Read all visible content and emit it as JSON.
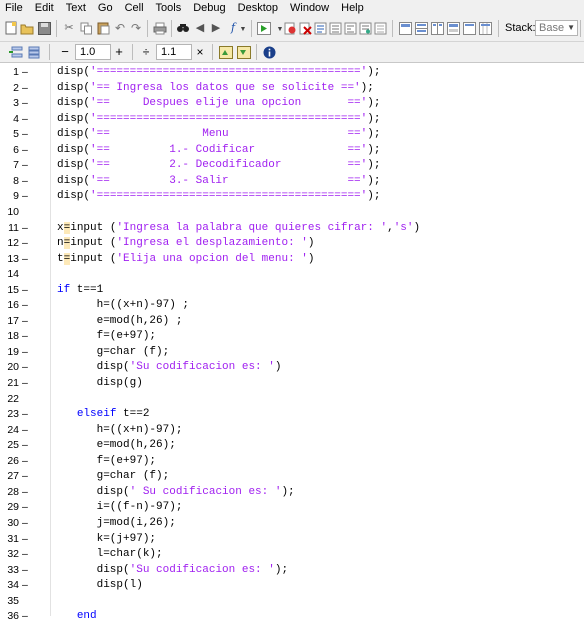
{
  "menu": [
    "File",
    "Edit",
    "Text",
    "Go",
    "Cell",
    "Tools",
    "Debug",
    "Desktop",
    "Window",
    "Help"
  ],
  "toolbar": {
    "stack_label": "Stack:",
    "stack_value": "Base",
    "cell_minus": "−",
    "cell_value_1": "1.0",
    "cell_plus": "+",
    "cell_divide": "÷",
    "cell_value_2": "1.1",
    "cell_times": "×"
  },
  "code_lines": [
    {
      "n": "1",
      "parts": [
        {
          "t": "disp(",
          "c": ""
        },
        {
          "t": "'========================================'",
          "c": "str"
        },
        {
          "t": ");",
          "c": ""
        }
      ]
    },
    {
      "n": "2",
      "parts": [
        {
          "t": "disp(",
          "c": ""
        },
        {
          "t": "'== Ingresa los datos que se solicite =='",
          "c": "str"
        },
        {
          "t": ");",
          "c": ""
        }
      ]
    },
    {
      "n": "3",
      "parts": [
        {
          "t": "disp(",
          "c": ""
        },
        {
          "t": "'==     Despues elije una opcion       =='",
          "c": "str"
        },
        {
          "t": ");",
          "c": ""
        }
      ]
    },
    {
      "n": "4",
      "parts": [
        {
          "t": "disp(",
          "c": ""
        },
        {
          "t": "'========================================'",
          "c": "str"
        },
        {
          "t": ");",
          "c": ""
        }
      ]
    },
    {
      "n": "5",
      "parts": [
        {
          "t": "disp(",
          "c": ""
        },
        {
          "t": "'==              Menu                  =='",
          "c": "str"
        },
        {
          "t": ");",
          "c": ""
        }
      ]
    },
    {
      "n": "6",
      "parts": [
        {
          "t": "disp(",
          "c": ""
        },
        {
          "t": "'==         1.- Codificar              =='",
          "c": "str"
        },
        {
          "t": ");",
          "c": ""
        }
      ]
    },
    {
      "n": "7",
      "parts": [
        {
          "t": "disp(",
          "c": ""
        },
        {
          "t": "'==         2.- Decodificador          =='",
          "c": "str"
        },
        {
          "t": ");",
          "c": ""
        }
      ]
    },
    {
      "n": "8",
      "parts": [
        {
          "t": "disp(",
          "c": ""
        },
        {
          "t": "'==         3.- Salir                  =='",
          "c": "str"
        },
        {
          "t": ");",
          "c": ""
        }
      ]
    },
    {
      "n": "9",
      "parts": [
        {
          "t": "disp(",
          "c": ""
        },
        {
          "t": "'========================================'",
          "c": "str"
        },
        {
          "t": ");",
          "c": ""
        }
      ]
    },
    {
      "n": "10",
      "dash": false,
      "parts": []
    },
    {
      "n": "11",
      "parts": [
        {
          "t": "x",
          "c": ""
        },
        {
          "t": "=",
          "c": "mark"
        },
        {
          "t": "input (",
          "c": ""
        },
        {
          "t": "'Ingresa la palabra que quieres cifrar: '",
          "c": "str"
        },
        {
          "t": ",",
          "c": ""
        },
        {
          "t": "'s'",
          "c": "str"
        },
        {
          "t": ")",
          "c": ""
        }
      ]
    },
    {
      "n": "12",
      "parts": [
        {
          "t": "n",
          "c": ""
        },
        {
          "t": "=",
          "c": "mark"
        },
        {
          "t": "input (",
          "c": ""
        },
        {
          "t": "'Ingresa el desplazamiento: '",
          "c": "str"
        },
        {
          "t": ")",
          "c": ""
        }
      ]
    },
    {
      "n": "13",
      "parts": [
        {
          "t": "t",
          "c": ""
        },
        {
          "t": "=",
          "c": "mark"
        },
        {
          "t": "input (",
          "c": ""
        },
        {
          "t": "'Elija una opcion del menu: '",
          "c": "str"
        },
        {
          "t": ")",
          "c": ""
        }
      ]
    },
    {
      "n": "14",
      "dash": false,
      "parts": []
    },
    {
      "n": "15",
      "parts": [
        {
          "t": "if",
          "c": "kw"
        },
        {
          "t": " t==1",
          "c": ""
        }
      ]
    },
    {
      "n": "16",
      "parts": [
        {
          "t": "      h=((x+n)-97) ;",
          "c": ""
        }
      ]
    },
    {
      "n": "17",
      "parts": [
        {
          "t": "      e=mod(h,26) ;",
          "c": ""
        }
      ]
    },
    {
      "n": "18",
      "parts": [
        {
          "t": "      f=(e+97);",
          "c": ""
        }
      ]
    },
    {
      "n": "19",
      "parts": [
        {
          "t": "      g=char (f);",
          "c": ""
        }
      ]
    },
    {
      "n": "20",
      "parts": [
        {
          "t": "      disp(",
          "c": ""
        },
        {
          "t": "'Su codificacion es: '",
          "c": "str"
        },
        {
          "t": ")",
          "c": ""
        }
      ]
    },
    {
      "n": "21",
      "parts": [
        {
          "t": "      disp(g)",
          "c": ""
        }
      ]
    },
    {
      "n": "22",
      "dash": false,
      "parts": []
    },
    {
      "n": "23",
      "parts": [
        {
          "t": "   ",
          "c": ""
        },
        {
          "t": "elseif",
          "c": "kw"
        },
        {
          "t": " t==2",
          "c": ""
        }
      ]
    },
    {
      "n": "24",
      "parts": [
        {
          "t": "      h=((x+n)-97);",
          "c": ""
        }
      ]
    },
    {
      "n": "25",
      "parts": [
        {
          "t": "      e=mod(h,26);",
          "c": ""
        }
      ]
    },
    {
      "n": "26",
      "parts": [
        {
          "t": "      f=(e+97);",
          "c": ""
        }
      ]
    },
    {
      "n": "27",
      "parts": [
        {
          "t": "      g=char (f);",
          "c": ""
        }
      ]
    },
    {
      "n": "28",
      "parts": [
        {
          "t": "      disp(",
          "c": ""
        },
        {
          "t": "' Su codificacion es: '",
          "c": "str"
        },
        {
          "t": ");",
          "c": ""
        }
      ]
    },
    {
      "n": "29",
      "parts": [
        {
          "t": "      i=((f-n)-97);",
          "c": ""
        }
      ]
    },
    {
      "n": "30",
      "parts": [
        {
          "t": "      j=mod(i,26);",
          "c": ""
        }
      ]
    },
    {
      "n": "31",
      "parts": [
        {
          "t": "      k=(j+97);",
          "c": ""
        }
      ]
    },
    {
      "n": "32",
      "parts": [
        {
          "t": "      l=char(k);",
          "c": ""
        }
      ]
    },
    {
      "n": "33",
      "parts": [
        {
          "t": "      disp(",
          "c": ""
        },
        {
          "t": "'Su codificacion es: '",
          "c": "str"
        },
        {
          "t": ");",
          "c": ""
        }
      ]
    },
    {
      "n": "34",
      "parts": [
        {
          "t": "      disp(l)",
          "c": ""
        }
      ]
    },
    {
      "n": "35",
      "dash": false,
      "parts": []
    },
    {
      "n": "36",
      "parts": [
        {
          "t": "   ",
          "c": ""
        },
        {
          "t": "end",
          "c": "kw"
        }
      ]
    }
  ]
}
